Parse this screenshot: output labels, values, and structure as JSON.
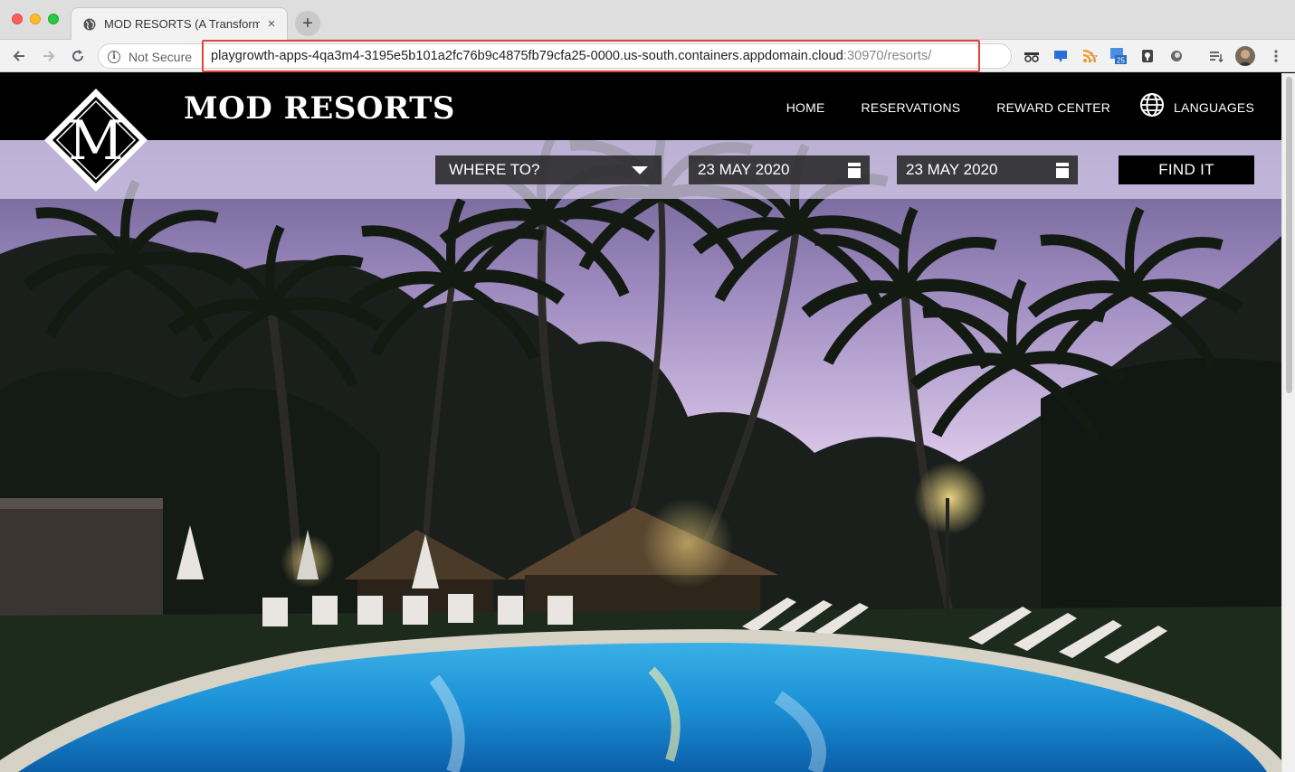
{
  "browser": {
    "tab": {
      "title": "MOD RESORTS (A Transformat",
      "close": "×"
    },
    "new_tab": "+",
    "security": "Not Secure",
    "url": {
      "host": "playgrowth-apps-4qa3m4-3195e5b101a2fc76b9c4875fb79cfa25-0000.us-south.containers.appdomain.cloud",
      "rest": ":30970/resorts/"
    },
    "extensions": [
      "incognito-mask-icon",
      "cast-icon",
      "rss-feed-icon",
      "calendar-badge-icon",
      "shield-icon",
      "circle-icon",
      "reading-list-icon",
      "profile-avatar"
    ],
    "calendar_badge": "25"
  },
  "site": {
    "brand": "MOD RESORTS",
    "logo_letter": "M",
    "nav": {
      "home": "HOME",
      "reservations": "RESERVATIONS",
      "reward_center": "REWARD CENTER",
      "languages": "LANGUAGES"
    },
    "search": {
      "destination": "WHERE TO?",
      "check_in": "23 MAY 2020",
      "check_out": "23 MAY 2020",
      "submit": "FIND IT"
    }
  },
  "colors": {
    "highlight_box": "#e3433a",
    "header_bg": "#000000",
    "search_band": "#dcd2f0"
  }
}
